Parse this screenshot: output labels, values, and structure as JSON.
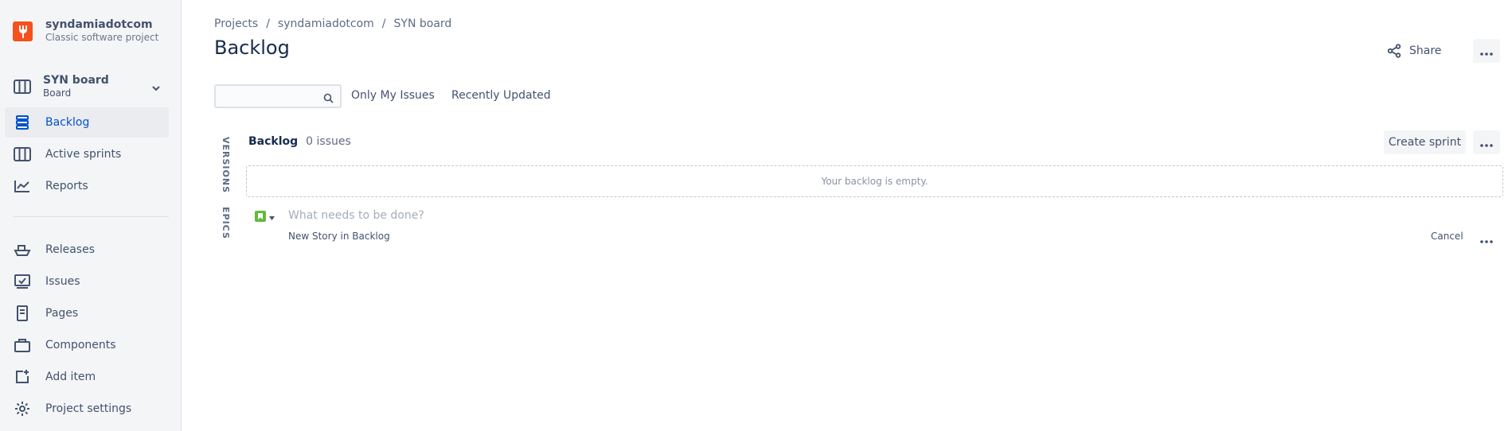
{
  "project": {
    "name": "syndamiadotcom",
    "type": "Classic software project"
  },
  "board": {
    "name": "SYN board",
    "subtitle": "Board"
  },
  "sidebar": {
    "items": [
      {
        "label": "Backlog",
        "icon": "backlog-icon",
        "active": true
      },
      {
        "label": "Active sprints",
        "icon": "board-columns-icon"
      },
      {
        "label": "Reports",
        "icon": "line-chart-icon"
      },
      {
        "label": "Releases",
        "icon": "ship-icon"
      },
      {
        "label": "Issues",
        "icon": "issues-icon"
      },
      {
        "label": "Pages",
        "icon": "page-icon"
      },
      {
        "label": "Components",
        "icon": "component-icon"
      },
      {
        "label": "Add item",
        "icon": "add-item-icon"
      },
      {
        "label": "Project settings",
        "icon": "gear-icon"
      }
    ]
  },
  "breadcrumb": [
    "Projects",
    "syndamiadotcom",
    "SYN board"
  ],
  "page": {
    "title": "Backlog",
    "share_label": "Share"
  },
  "filters": {
    "search_placeholder": "",
    "only_my_issues": "Only My Issues",
    "recently_updated": "Recently Updated"
  },
  "side_tabs": {
    "versions": "VERSIONS",
    "epics": "EPICS"
  },
  "backlog": {
    "title": "Backlog",
    "count": "0 issues",
    "create_sprint": "Create sprint",
    "empty_message": "Your backlog is empty."
  },
  "new_issue": {
    "placeholder": "What needs to be done?",
    "hint": "New Story in Backlog",
    "cancel": "Cancel"
  },
  "colors": {
    "accent": "#0052cc",
    "project_avatar": "#f4511e",
    "story": "#63ba3c"
  }
}
